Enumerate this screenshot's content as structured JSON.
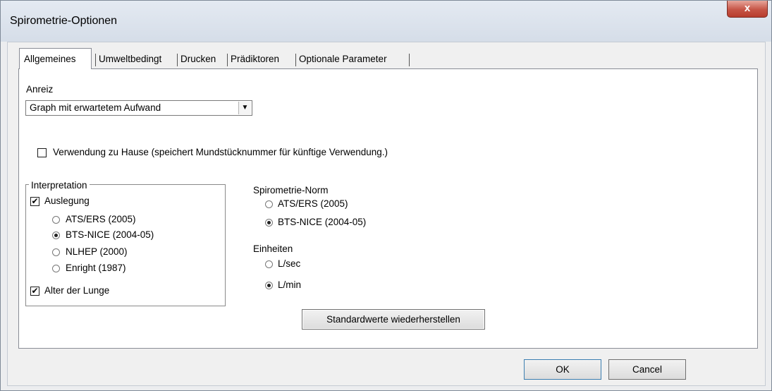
{
  "window": {
    "title": "Spirometrie-Optionen",
    "close_label": "x"
  },
  "tabs": [
    {
      "label": "Allgemeines",
      "active": true
    },
    {
      "label": "Umweltbedingt",
      "active": false
    },
    {
      "label": "Drucken",
      "active": false
    },
    {
      "label": "Prädiktoren",
      "active": false
    },
    {
      "label": "Optionale Parameter",
      "active": false
    }
  ],
  "anreiz": {
    "label": "Anreiz",
    "selected": "Graph mit erwartetem Aufwand"
  },
  "home_use": {
    "label": "Verwendung zu Hause (speichert Mundstücknummer für künftige Verwendung.)",
    "checked": false
  },
  "interpretation": {
    "title": "Interpretation",
    "auslegung": {
      "label": "Auslegung",
      "checked": true
    },
    "options": [
      {
        "label": "ATS/ERS (2005)",
        "selected": false
      },
      {
        "label": "BTS-NICE (2004-05)",
        "selected": true
      },
      {
        "label": "NLHEP (2000)",
        "selected": false
      },
      {
        "label": "Enright (1987)",
        "selected": false
      }
    ],
    "lung_age": {
      "label": "Alter der Lunge",
      "checked": true
    }
  },
  "norm": {
    "label": "Spirometrie-Norm",
    "options": [
      {
        "label": "ATS/ERS (2005)",
        "selected": false
      },
      {
        "label": "BTS-NICE (2004-05)",
        "selected": true
      }
    ]
  },
  "units": {
    "label": "Einheiten",
    "options": [
      {
        "label": "L/sec",
        "selected": false
      },
      {
        "label": "L/min",
        "selected": true
      }
    ]
  },
  "buttons": {
    "restore": "Standardwerte wiederherstellen",
    "ok": "OK",
    "cancel": "Cancel"
  }
}
